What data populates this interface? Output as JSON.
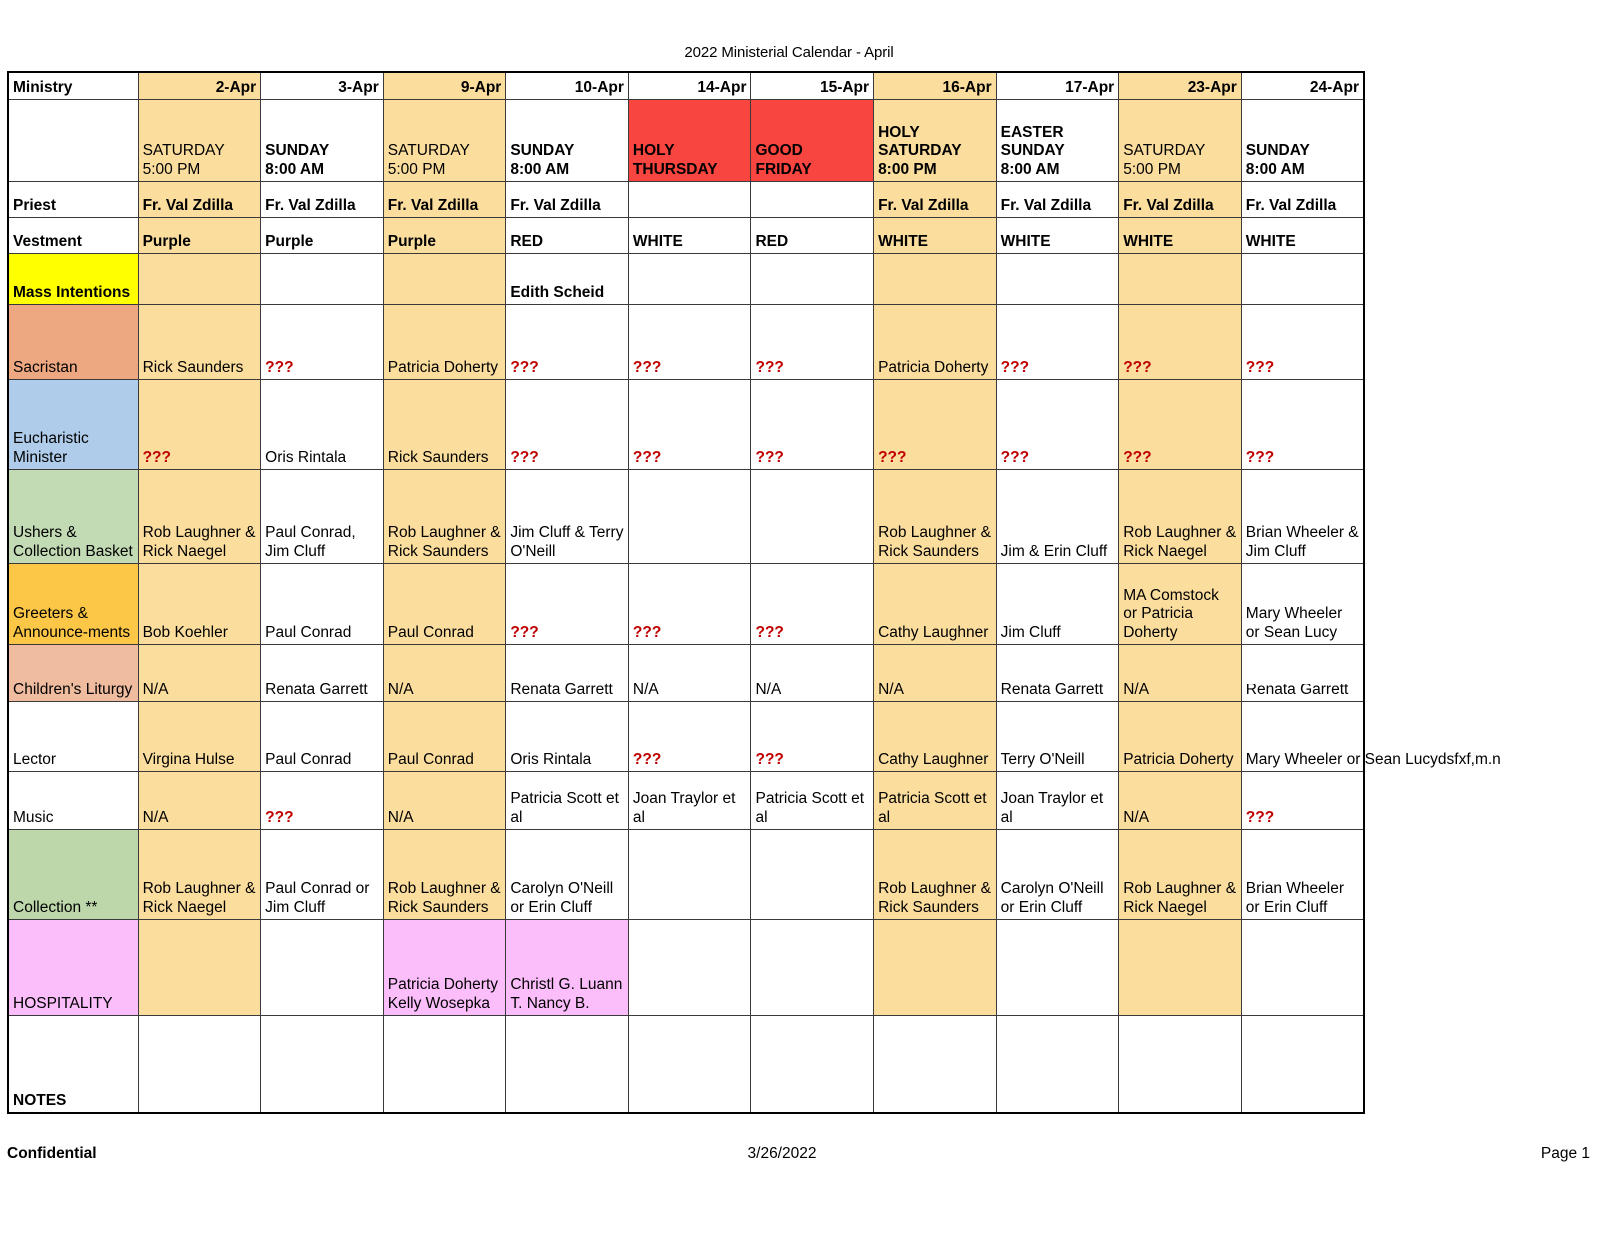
{
  "document": {
    "title": "2022 Ministerial Calendar - April",
    "footer_left": "Confidential",
    "footer_center": "3/26/2022",
    "footer_right": "Page 1"
  },
  "columns": [
    {
      "key": "apr2",
      "date": "2-Apr",
      "day": "SATURDAY",
      "time": "5:00 PM",
      "highlight": "saturday"
    },
    {
      "key": "apr3",
      "date": "3-Apr",
      "day": "SUNDAY",
      "time": "8:00 AM",
      "highlight": "none"
    },
    {
      "key": "apr9",
      "date": "9-Apr",
      "day": "SATURDAY",
      "time": "5:00 PM",
      "highlight": "saturday"
    },
    {
      "key": "apr10",
      "date": "10-Apr",
      "day": "SUNDAY",
      "time": "8:00 AM",
      "highlight": "none"
    },
    {
      "key": "apr14",
      "date": "14-Apr",
      "day": "HOLY",
      "time": "THURSDAY",
      "highlight": "red"
    },
    {
      "key": "apr15",
      "date": "15-Apr",
      "day": "GOOD",
      "time": "FRIDAY",
      "highlight": "red"
    },
    {
      "key": "apr16",
      "date": "16-Apr",
      "day": "HOLY SATURDAY",
      "time": "8:00 PM",
      "highlight": "saturday"
    },
    {
      "key": "apr17",
      "date": "17-Apr",
      "day": "EASTER SUNDAY",
      "time": "8:00 AM",
      "highlight": "none"
    },
    {
      "key": "apr23",
      "date": "23-Apr",
      "day": "SATURDAY",
      "time": "5:00 PM",
      "highlight": "saturday"
    },
    {
      "key": "apr24",
      "date": "24-Apr",
      "day": "SUNDAY",
      "time": "8:00 AM",
      "highlight": "none"
    }
  ],
  "header": {
    "ministry_label": "Ministry"
  },
  "rows": {
    "priest": {
      "label": "Priest",
      "values": [
        "Fr. Val Zdilla",
        "Fr. Val Zdilla",
        "Fr. Val Zdilla",
        "Fr. Val Zdilla",
        "",
        "",
        "Fr. Val Zdilla",
        "Fr. Val Zdilla",
        "Fr. Val Zdilla",
        "Fr. Val Zdilla"
      ]
    },
    "vestment": {
      "label": "Vestment",
      "values": [
        "Purple",
        "Purple",
        "Purple",
        "RED",
        "WHITE",
        "RED",
        "WHITE",
        "WHITE",
        "WHITE",
        "WHITE"
      ]
    },
    "mass_intentions": {
      "label": "Mass Intentions",
      "values": [
        "",
        "",
        "",
        "Edith Scheid",
        "",
        "",
        "",
        "",
        "",
        ""
      ]
    },
    "sacristan": {
      "label": "Sacristan",
      "values": [
        "Rick Saunders",
        "???",
        "Patricia Doherty",
        "???",
        "???",
        "???",
        "Patricia Doherty",
        "???",
        "???",
        "???"
      ]
    },
    "eucharistic_minister": {
      "label": "Eucharistic Minister",
      "values": [
        "???",
        "Oris Rintala",
        "Rick Saunders",
        "???",
        "???",
        "???",
        "???",
        "???",
        "???",
        "???"
      ]
    },
    "ushers": {
      "label": "Ushers & Collection Basket",
      "values": [
        "Rob Laughner & Rick Naegel",
        "Paul Conrad, Jim Cluff",
        "Rob Laughner & Rick Saunders",
        "Jim Cluff & Terry O'Neill",
        "",
        "",
        "Rob Laughner & Rick Saunders",
        "Jim & Erin Cluff",
        "Rob Laughner & Rick Naegel",
        "Brian Wheeler & Jim Cluff"
      ]
    },
    "greeters": {
      "label": "Greeters & Announce-ments",
      "values": [
        "Bob Koehler",
        "Paul Conrad",
        "Paul Conrad",
        "???",
        "???",
        "???",
        "Cathy Laughner",
        "Jim Cluff",
        "MA Comstock or Patricia Doherty",
        "Mary Wheeler or Sean Lucy"
      ]
    },
    "childrens_liturgy": {
      "label": "Children's Liturgy",
      "values": [
        "N/A",
        "Renata Garrett",
        "N/A",
        "Renata Garrett",
        "N/A",
        "N/A",
        "N/A",
        "Renata Garrett",
        "N/A",
        "Renata Garrett"
      ]
    },
    "lector": {
      "label": "Lector",
      "values": [
        "Virgina Hulse",
        "Paul Conrad",
        "Paul Conrad",
        "Oris Rintala",
        "???",
        "???",
        "Cathy Laughner",
        "Terry O'Neill",
        "Patricia Doherty",
        "Mary Wheeler or Sean Lucydsfxf,m.n"
      ]
    },
    "music": {
      "label": "Music",
      "values": [
        "N/A",
        "???",
        "N/A",
        "Patricia Scott et al",
        "Joan Traylor et al",
        "Patricia Scott et al",
        "Patricia Scott et al",
        "Joan Traylor et al",
        "N/A",
        "???"
      ]
    },
    "collection": {
      "label": "Collection **",
      "values": [
        "Rob Laughner & Rick Naegel",
        "Paul Conrad or Jim Cluff",
        "Rob Laughner & Rick Saunders",
        "Carolyn O'Neill or Erin Cluff",
        "",
        "",
        "Rob Laughner & Rick Saunders",
        "Carolyn O'Neill or Erin Cluff",
        "Rob Laughner & Rick Naegel",
        "Brian Wheeler or Erin Cluff"
      ]
    },
    "hospitality": {
      "label": "HOSPITALITY",
      "values": [
        "",
        "",
        "Patricia Doherty Kelly Wosepka",
        "Christl G. Luann T. Nancy B.",
        "",
        "",
        "",
        "",
        "",
        ""
      ]
    },
    "notes": {
      "label": "NOTES",
      "values": [
        "",
        "",
        "",
        "",
        "",
        "",
        "",
        "",
        "",
        ""
      ]
    }
  },
  "colors": {
    "saturday_highlight": "#FBDD9E",
    "red_header": "#F9453F",
    "mass_intentions_label": "#FFFF00",
    "sacristan_label": "#EDA882",
    "eucharistic_label": "#AFCDEA",
    "ushers_label": "#C3DBB4",
    "greeters_label": "#FCC747",
    "childrens_label": "#F0BCA0",
    "collection_label": "#BDD7AB",
    "hospitality_label": "#FBBEFB",
    "unassigned_marker": "#C00000"
  }
}
